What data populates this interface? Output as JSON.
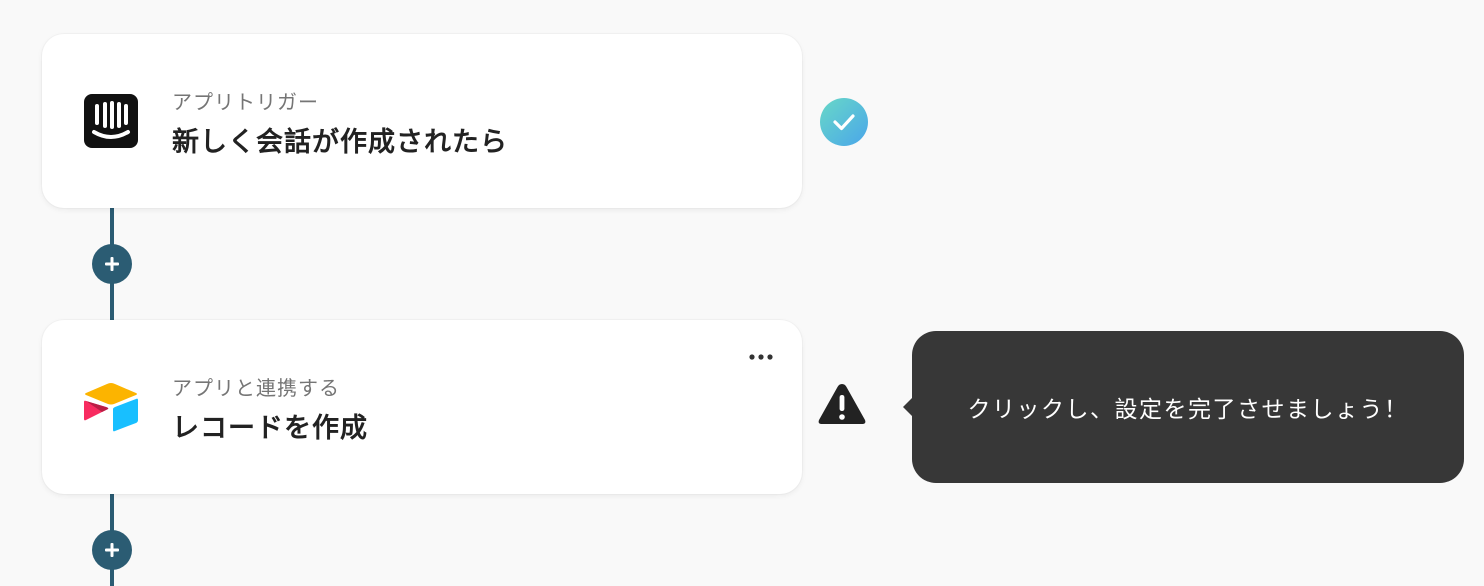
{
  "steps": [
    {
      "app_icon": "intercom-icon",
      "subtitle": "アプリトリガー",
      "title": "新しく会話が作成されたら",
      "status": "complete",
      "status_icon": "check-icon"
    },
    {
      "app_icon": "airtable-icon",
      "subtitle": "アプリと連携する",
      "title": "レコードを作成",
      "status": "incomplete",
      "status_icon": "warning-icon",
      "menu_icon": "more-horizontal-icon"
    }
  ],
  "tooltip": {
    "text": "クリックし、設定を完了させましょう！"
  },
  "add_step_icon": "plus-icon",
  "colors": {
    "background": "#f9f9f9",
    "connector": "#2b5c73",
    "check_gradient_start": "#68d8c7",
    "check_gradient_end": "#4aa6ea",
    "tooltip_bg": "#373737",
    "warning": "#222222",
    "title_text": "#222222",
    "subtitle_text": "#757575"
  }
}
